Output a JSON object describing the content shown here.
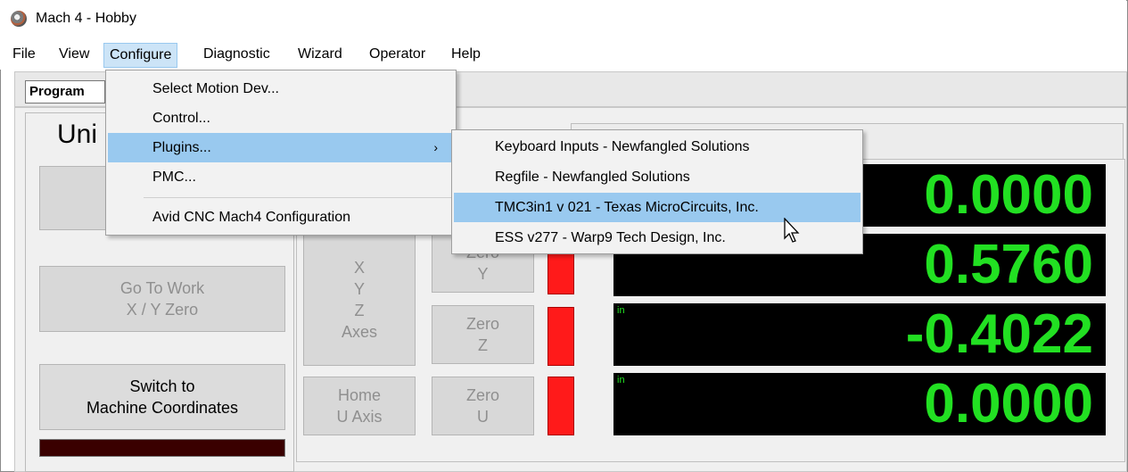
{
  "window": {
    "title": "Mach 4 - Hobby"
  },
  "menubar": {
    "items": [
      {
        "label": "File"
      },
      {
        "label": "View"
      },
      {
        "label": "Configure"
      },
      {
        "label": "Diagnostic"
      },
      {
        "label": "Wizard"
      },
      {
        "label": "Operator"
      },
      {
        "label": "Help"
      }
    ]
  },
  "tabs": {
    "program_label": "Program"
  },
  "panel_left": {
    "units_label": "Uni",
    "go_to_work": {
      "line1": "Go To Work",
      "line2": "X / Y Zero"
    },
    "switch_coords": {
      "line1": "Switch to",
      "line2": "Machine Coordinates"
    }
  },
  "axes_button": {
    "lines": [
      "X",
      "Y",
      "Z",
      "Axes"
    ]
  },
  "home_u": {
    "line1": "Home",
    "line2": "U  Axis"
  },
  "zero_y": {
    "line1": "Zero",
    "line2": "Y"
  },
  "zero_z": {
    "line1": "Zero",
    "line2": "Z"
  },
  "zero_u": {
    "line1": "Zero",
    "line2": "U"
  },
  "dro": [
    {
      "value": "0.0000",
      "unit": ""
    },
    {
      "value": "0.5760",
      "unit": ""
    },
    {
      "value": "-0.4022",
      "unit": "in"
    },
    {
      "value": "0.0000",
      "unit": "in"
    }
  ],
  "configure_menu": {
    "items": [
      {
        "label": "Select Motion Dev..."
      },
      {
        "label": "Control..."
      },
      {
        "label": "Plugins...",
        "has_submenu": true,
        "arrow": "›"
      },
      {
        "label": "PMC..."
      },
      {
        "label": "Avid CNC Mach4 Configuration"
      }
    ]
  },
  "plugins_submenu": {
    "items": [
      {
        "label": "Keyboard Inputs - Newfangled Solutions"
      },
      {
        "label": "Regfile - Newfangled Solutions"
      },
      {
        "label": "TMC3in1 v 021 - Texas MicroCircuits, Inc."
      },
      {
        "label": "ESS v277 - Warp9 Tech Design, Inc."
      }
    ]
  },
  "colors": {
    "menu_highlight": "#99c9ef",
    "dro_digits": "#22e022",
    "led_red": "#ff1a1a"
  }
}
